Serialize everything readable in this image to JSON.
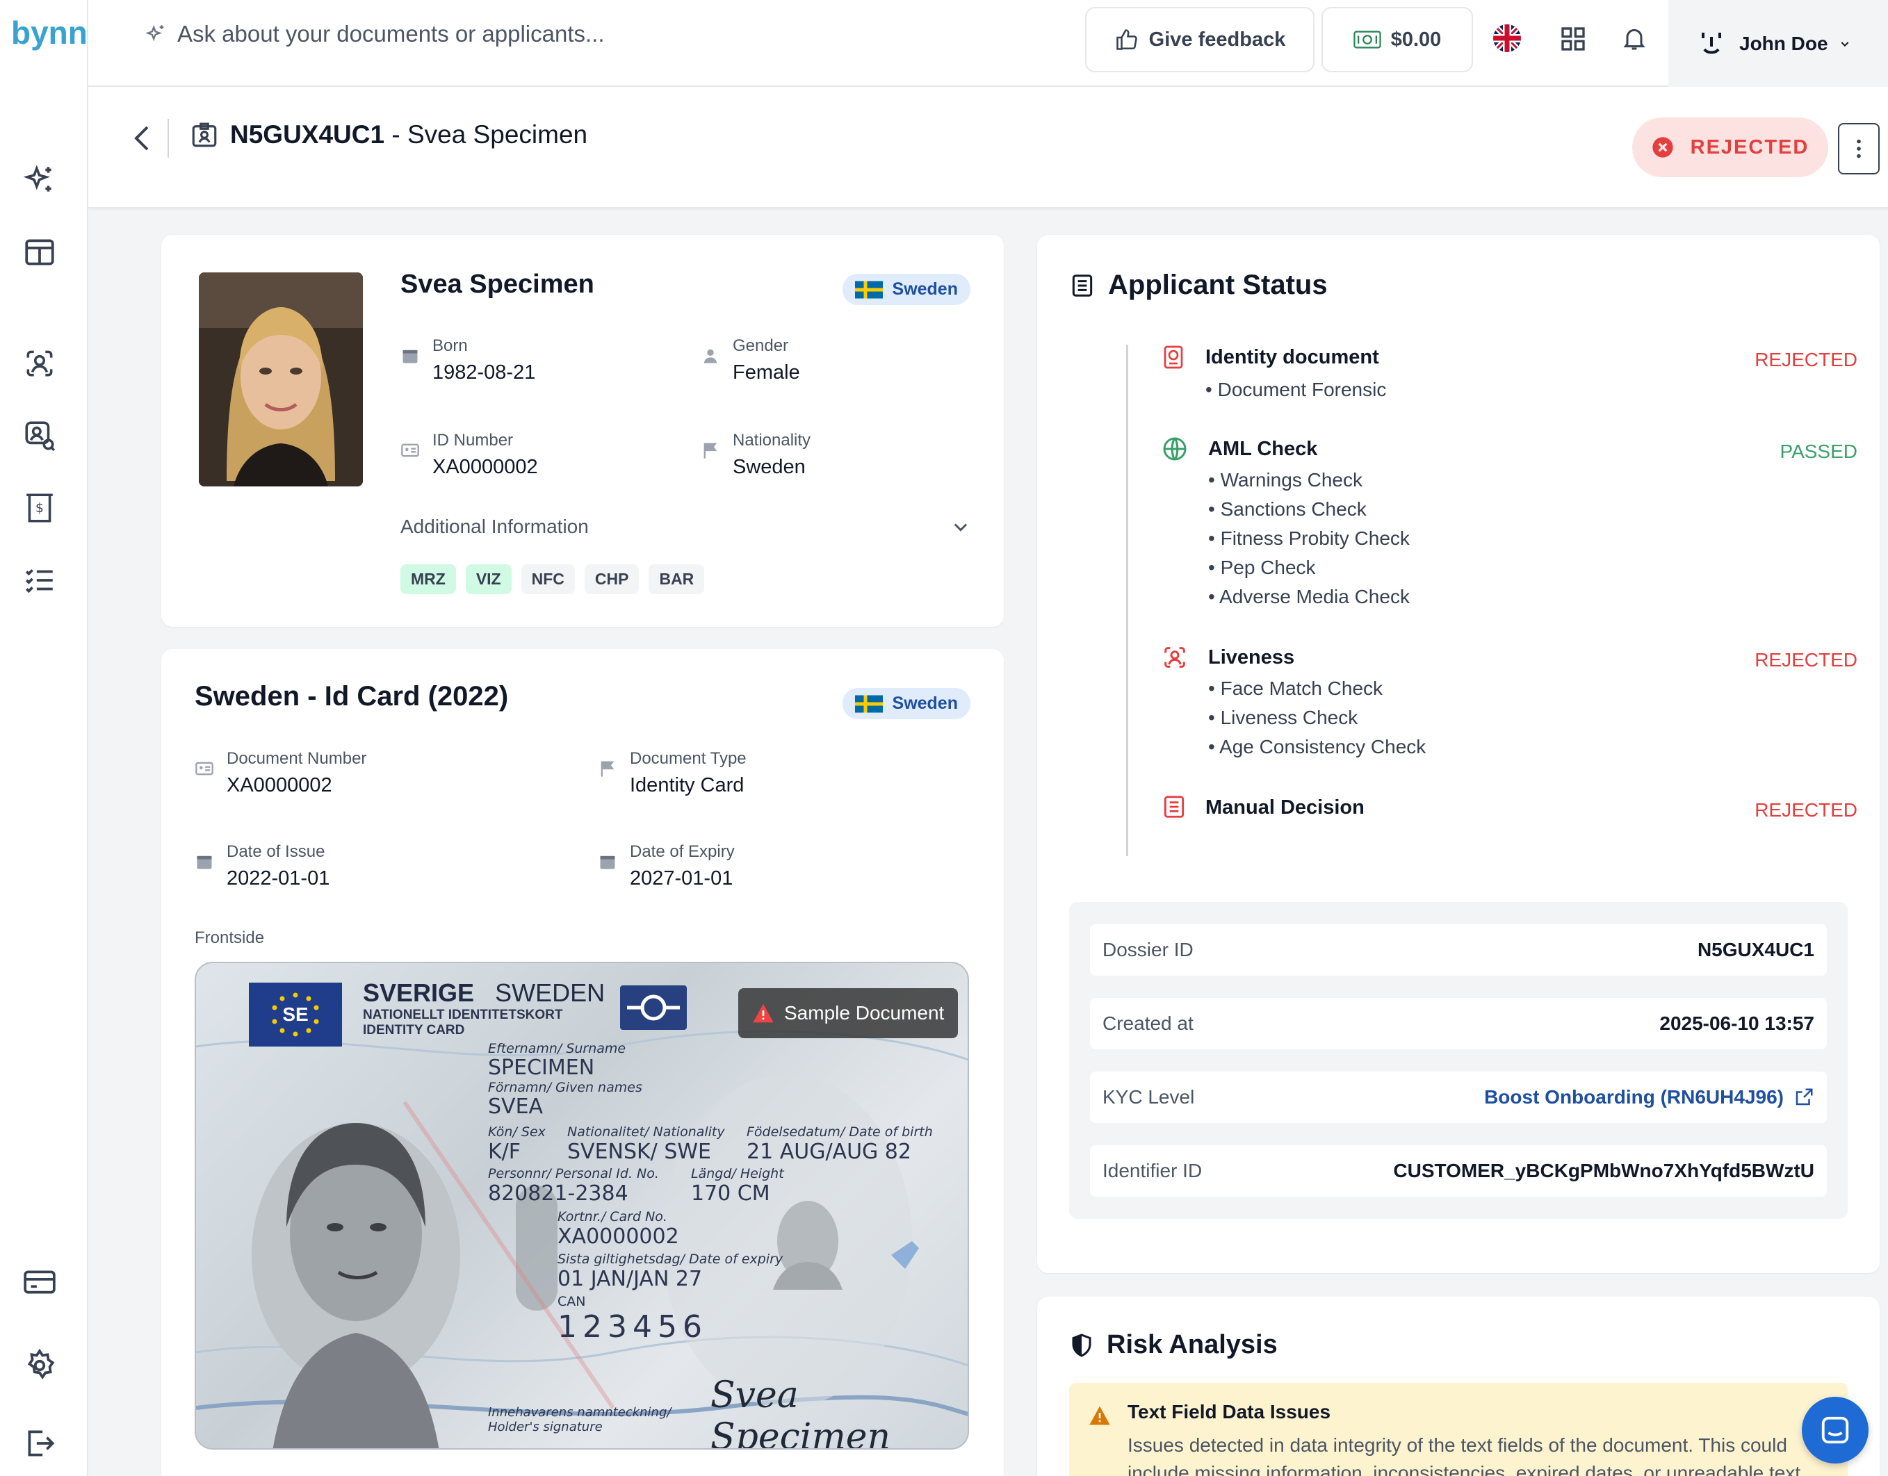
{
  "app": {
    "logo": "bynn"
  },
  "topbar": {
    "ask_placeholder": "Ask about your documents or applicants...",
    "feedback_label": "Give feedback",
    "balance": "$0.00",
    "user_name": "John Doe"
  },
  "header": {
    "title_id": "N5GUX4UC1",
    "title_sep": " - ",
    "title_name": "Svea Specimen",
    "status": "REJECTED"
  },
  "applicant": {
    "name": "Svea Specimen",
    "country": "Sweden",
    "born_label": "Born",
    "born": "1982-08-21",
    "gender_label": "Gender",
    "gender": "Female",
    "id_label": "ID Number",
    "id_number": "XA0000002",
    "nationality_label": "Nationality",
    "nationality": "Sweden",
    "additional_label": "Additional Information",
    "tags": [
      "MRZ",
      "VIZ",
      "NFC",
      "CHP",
      "BAR"
    ]
  },
  "document": {
    "title": "Sweden - Id Card (2022)",
    "country": "Sweden",
    "number_label": "Document Number",
    "number": "XA0000002",
    "type_label": "Document Type",
    "type": "Identity Card",
    "issue_label": "Date of Issue",
    "issue": "2022-01-01",
    "expiry_label": "Date of Expiry",
    "expiry": "2027-01-01",
    "frontside_label": "Frontside",
    "sample_label": "Sample Document",
    "card": {
      "country_line1": "SVERIGE",
      "country_line2": "SWEDEN",
      "subtitle1": "NATIONELLT IDENTITETSKORT",
      "subtitle2": "IDENTITY CARD",
      "se_code": "SE",
      "surname_label": "Efternamn/ Surname",
      "surname": "SPECIMEN",
      "given_label": "Förnamn/ Given names",
      "given": "SVEA",
      "sex_label": "Kön/ Sex",
      "sex": "K/F",
      "nat_label": "Nationalitet/ Nationality",
      "nat": "SVENSK/ SWE",
      "dob_label": "Födelsedatum/ Date of birth",
      "dob": "21 AUG/AUG 82",
      "pno_label": "Personnr/ Personal Id. No.",
      "pno": "820821-2384",
      "height_label": "Längd/ Height",
      "height": "170 CM",
      "cardno_label": "Kortnr./ Card No.",
      "cardno": "XA0000002",
      "exp_label": "Sista giltighetsdag/ Date of expiry",
      "exp": "01 JAN/JAN 27",
      "can_label": "CAN",
      "can": "123456",
      "sig_label": "Innehavarens namnteckning/ Holder's signature",
      "signature": "Svea Specimen"
    }
  },
  "status": {
    "title": "Applicant Status",
    "items": [
      {
        "title": "Identity document",
        "checks": [
          "Document Forensic"
        ],
        "state": "REJECTED"
      },
      {
        "title": "AML Check",
        "checks": [
          "Warnings Check",
          "Sanctions Check",
          "Fitness Probity Check",
          "Pep Check",
          "Adverse Media Check"
        ],
        "state": "PASSED"
      },
      {
        "title": "Liveness",
        "checks": [
          "Face Match Check",
          "Liveness Check",
          "Age Consistency Check"
        ],
        "state": "REJECTED"
      },
      {
        "title": "Manual Decision",
        "checks": [],
        "state": "REJECTED"
      }
    ],
    "info": {
      "dossier_label": "Dossier ID",
      "dossier": "N5GUX4UC1",
      "created_label": "Created at",
      "created": "2025-06-10 13:57",
      "kyc_label": "KYC Level",
      "kyc": "Boost Onboarding (RN6UH4J96)",
      "identifier_label": "Identifier ID",
      "identifier": "CUSTOMER_yBCKgPMbWno7XhYqfd5BWztU"
    }
  },
  "risk": {
    "title": "Risk Analysis",
    "issue_title": "Text Field Data Issues",
    "issue_text": "Issues detected in data integrity of the text fields of the document. This could include missing information, inconsistencies, expired dates, or unreadable text."
  },
  "colors": {
    "rejected": "#e53e3e",
    "passed": "#38a169",
    "link": "#1e4fa0",
    "accent": "#38a3d1"
  }
}
